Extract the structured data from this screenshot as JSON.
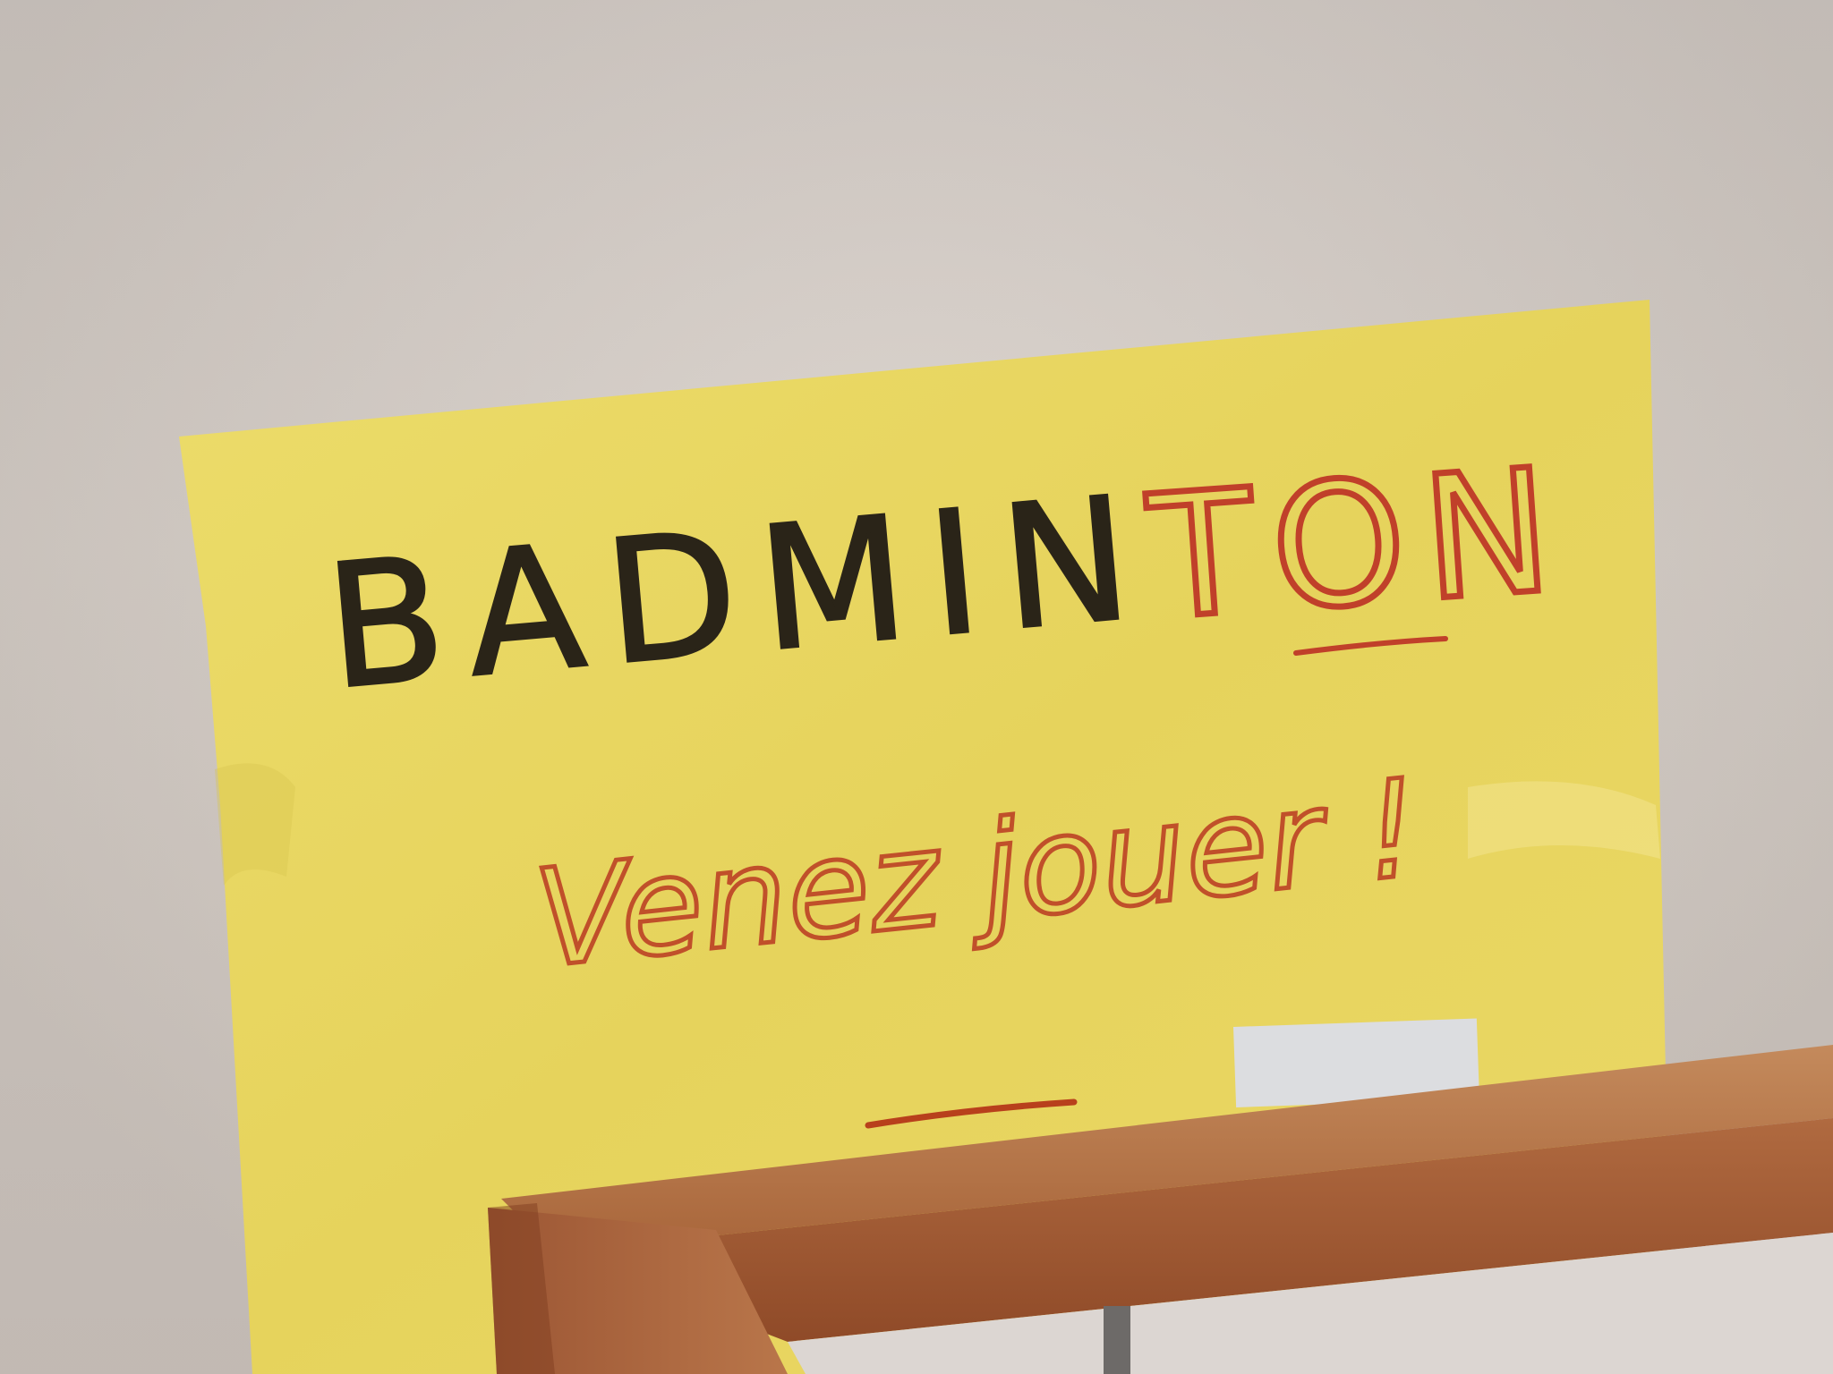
{
  "poster": {
    "line1_part1": "BADMIN",
    "line1_part2": "TON",
    "line2": "Venez jouer !",
    "paper_color": "#e9d862",
    "ink_dark": "#2a2418",
    "ink_red": "#b8401c"
  }
}
